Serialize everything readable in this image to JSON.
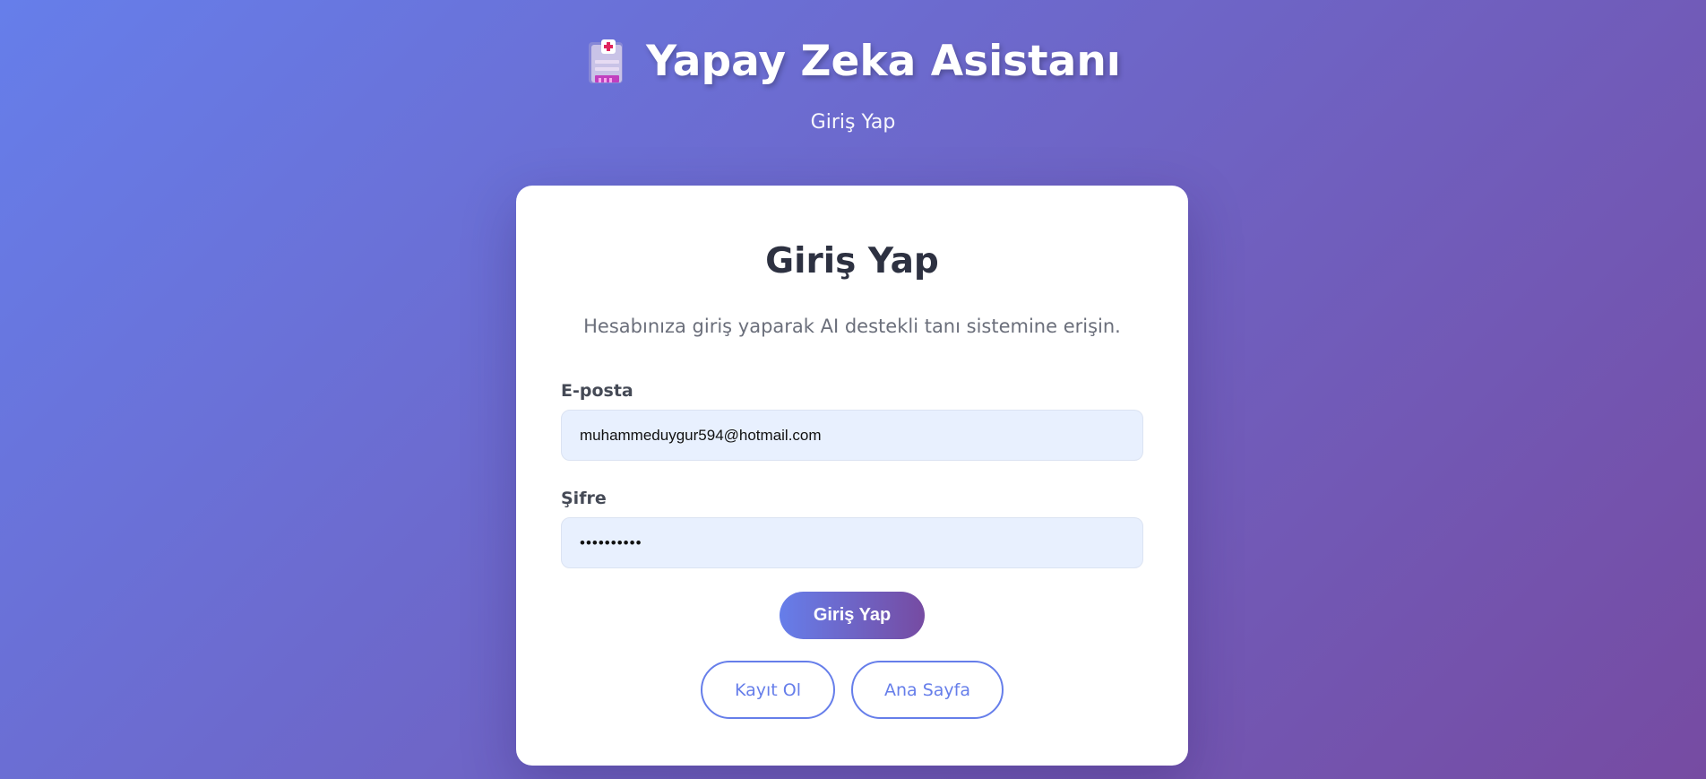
{
  "header": {
    "title": "Yapay Zeka Asistanı",
    "title_icon": "hospital-building-icon",
    "subtitle": "Giriş Yap"
  },
  "login_card": {
    "title": "Giriş Yap",
    "description": "Hesabınıza giriş yaparak AI destekli tanı sistemine erişin.",
    "email": {
      "label": "E-posta",
      "value": "muhammeduygur594@hotmail.com"
    },
    "password": {
      "label": "Şifre",
      "value": "••••••••••"
    },
    "submit_label": "Giriş Yap",
    "register_label": "Kayıt Ol",
    "home_label": "Ana Sayfa"
  },
  "colors": {
    "gradient_start": "#667eea",
    "gradient_end": "#764ba2",
    "card_background": "#ffffff",
    "input_background": "#e8f0fe",
    "title_text": "#2d3141",
    "accent": "#667eea"
  }
}
